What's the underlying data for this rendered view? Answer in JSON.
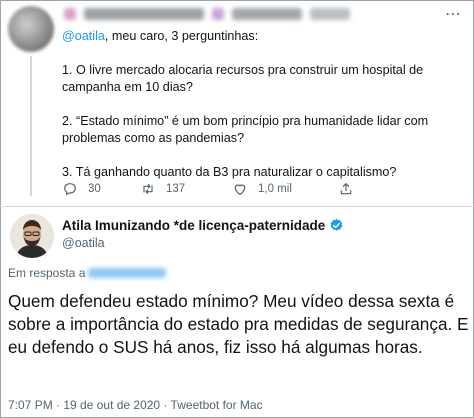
{
  "reply_tweet": {
    "more_icon": "more-dots-icon",
    "mention": "@oatila",
    "intro_rest": ", meu caro, 3 perguntinhas:",
    "q1": "1. O livre mercado alocaria recursos pra construir um hospital de campanha em 10 dias?",
    "q2": "2. “Estado mínimo” é um bom princípio pra humanidade lidar com problemas como as pandemias?",
    "q3": "3. Tá ganhando quanto da B3 pra naturalizar o capitalismo?",
    "actions": {
      "reply_count": "30",
      "retweet_count": "137",
      "like_count": "1,0 mil"
    }
  },
  "main_tweet": {
    "display_name": "Atila Imunizando *de licença-paternidade",
    "handle": "@oatila",
    "in_reply_prefix": "Em resposta a",
    "text": "Quem defendeu estado mínimo? Meu vídeo dessa sexta é sobre a importância do estado pra medidas de segurança. E eu defendo o SUS há anos, fiz isso há algumas horas.",
    "meta": "7:07 PM · 19 de out de 2020 · Tweetbot for Mac"
  },
  "colors": {
    "link": "#1d9bf0",
    "muted": "#536471",
    "text": "#0f1419",
    "verified": "#1d9bf0"
  }
}
